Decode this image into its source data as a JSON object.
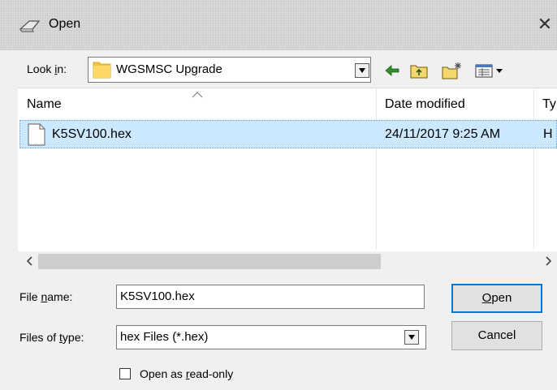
{
  "window": {
    "title": "Open",
    "close_glyph": "✕"
  },
  "lookin": {
    "label_pre": "Look ",
    "label_key": "i",
    "label_post": "n:",
    "value": "WGSMSC Upgrade",
    "icons": [
      "back-arrow-icon",
      "up-folder-icon",
      "new-folder-icon",
      "view-menu-icon"
    ]
  },
  "list": {
    "columns": [
      "Name",
      "Date modified",
      "Ty"
    ],
    "rows": [
      {
        "name": "K5SV100.hex",
        "date": "24/11/2017 9:25 AM",
        "type": "H"
      }
    ]
  },
  "scrollbar": {
    "left_glyph": "‹",
    "right_glyph": "›"
  },
  "form": {
    "filename_label_pre": "File ",
    "filename_label_key": "n",
    "filename_label_post": "ame:",
    "filename_value": "K5SV100.hex",
    "filetype_label_pre": "Files of ",
    "filetype_label_key": "t",
    "filetype_label_post": "ype:",
    "filetype_value": "hex Files (*.hex)",
    "open_key": "O",
    "open_rest": "pen",
    "cancel_label": "Cancel",
    "readonly_pre": "Open as ",
    "readonly_key": "r",
    "readonly_post": "ead-only"
  },
  "colors": {
    "selection": "#cce8ff",
    "accent": "#0078d7",
    "folder": "#f5c242"
  }
}
